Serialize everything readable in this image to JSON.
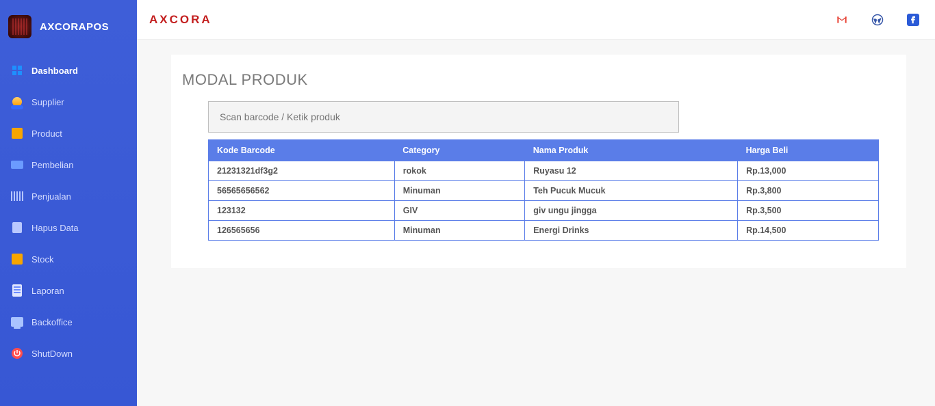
{
  "brand": "AXCORAPOS",
  "header_brand": "AXCORA",
  "sidebar": [
    {
      "label": "Dashboard",
      "icon": "grid-icon",
      "active": true
    },
    {
      "label": "Supplier",
      "icon": "person-icon",
      "active": false
    },
    {
      "label": "Product",
      "icon": "box-icon",
      "active": false
    },
    {
      "label": "Pembelian",
      "icon": "truck-icon",
      "active": false
    },
    {
      "label": "Penjualan",
      "icon": "barcode-icon",
      "active": false
    },
    {
      "label": "Hapus Data",
      "icon": "trash-icon",
      "active": false
    },
    {
      "label": "Stock",
      "icon": "box-icon",
      "active": false
    },
    {
      "label": "Laporan",
      "icon": "doc-icon",
      "active": false
    },
    {
      "label": "Backoffice",
      "icon": "monitor-icon",
      "active": false
    },
    {
      "label": "ShutDown",
      "icon": "power-icon",
      "active": false
    }
  ],
  "page": {
    "title": "MODAL PRODUK"
  },
  "search": {
    "placeholder": "Scan barcode / Ketik produk",
    "value": ""
  },
  "table": {
    "headers": [
      "Kode Barcode",
      "Category",
      "Nama Produk",
      "Harga Beli"
    ],
    "rows": [
      {
        "barcode": "21231321df3g2",
        "category": "rokok",
        "name": "Ruyasu 12",
        "price": "Rp.13,000"
      },
      {
        "barcode": "56565656562",
        "category": "Minuman",
        "name": "Teh Pucuk Mucuk",
        "price": "Rp.3,800"
      },
      {
        "barcode": "123132",
        "category": "GIV",
        "name": "giv ungu jingga",
        "price": "Rp.3,500"
      },
      {
        "barcode": "126565656",
        "category": "Minuman",
        "name": "Energi Drinks",
        "price": "Rp.14,500"
      }
    ]
  }
}
